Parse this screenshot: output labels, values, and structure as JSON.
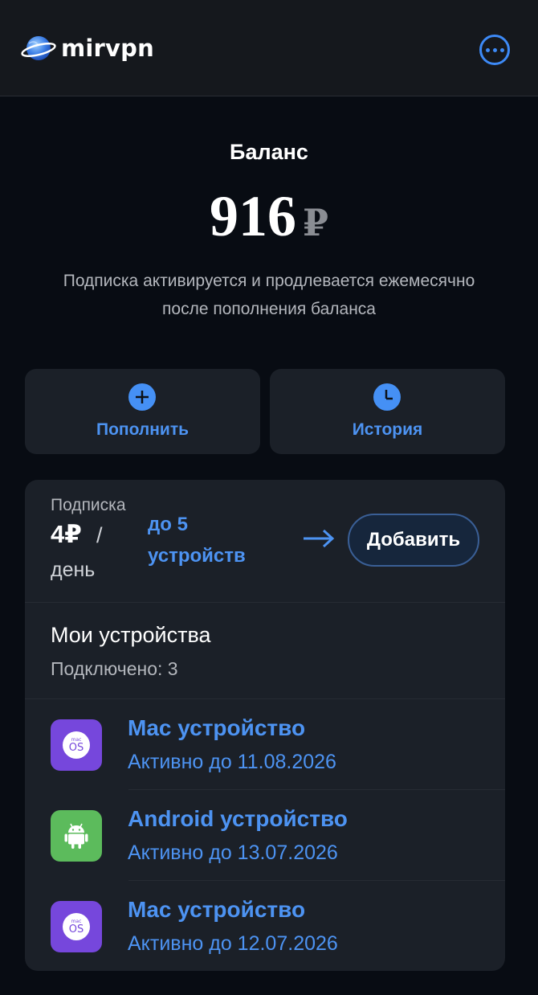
{
  "header": {
    "logo_text": "mirvpn",
    "menu_icon": "more-horizontal-icon"
  },
  "balance": {
    "label": "Баланс",
    "amount": "916",
    "currency": "₽",
    "note_line1": "Подписка активируется и продлевается ежемесячно",
    "note_line2": "после пополнения баланса"
  },
  "actions": {
    "topup_label": "Пополнить",
    "topup_icon": "plus-circle-icon",
    "history_label": "История",
    "history_icon": "clock-icon"
  },
  "subscription": {
    "title": "Подписка",
    "price": "4₽",
    "slash": "/",
    "period": "день",
    "devices_line1": "до 5",
    "devices_line2": "устройств",
    "add_label": "Добавить"
  },
  "my_devices": {
    "title": "Мои устройства",
    "connected": "Подключено: 3",
    "items": [
      {
        "name": "Mac устройство",
        "status": "Активно до 11.08.2026",
        "type": "mac",
        "icon_text_small": "mac",
        "icon_text": "OS"
      },
      {
        "name": "Android устройство",
        "status": "Активно до 13.07.2026",
        "type": "android"
      },
      {
        "name": "Mac устройство",
        "status": "Активно до 12.07.2026",
        "type": "mac",
        "icon_text_small": "mac",
        "icon_text": "OS"
      }
    ]
  },
  "colors": {
    "accent": "#4d93f2",
    "background": "#080c13",
    "card": "#1b2028",
    "mac_icon": "#7647dc",
    "android_icon": "#5cbb5c"
  }
}
